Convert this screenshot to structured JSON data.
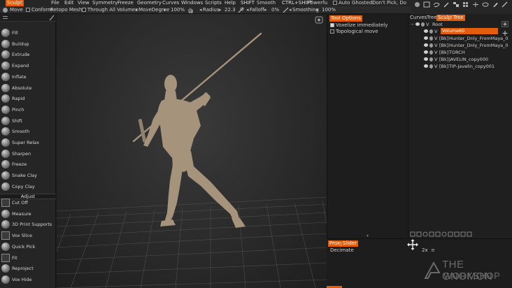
{
  "menubar": {
    "room": "Sculpt",
    "items": [
      "File",
      "Edit",
      "View",
      "Symmetry",
      "Freeze",
      "Geometry",
      "Curves",
      "Windows",
      "Scripts",
      "Help"
    ],
    "shift_label": "SHIFT",
    "shift_value": "Smooth",
    "ctrl_shift_label": "CTRL+SHIFT",
    "ctrl_shift_value": "Powerfu",
    "auto_label": "Auto",
    "ghosted_label": "Ghosted:",
    "ghosted_value": "Don't Pick, Do"
  },
  "options_bar": {
    "move": "Move",
    "conform": "Conform",
    "retopo_mesh": "Retopo  Mesh",
    "through_all_volumes": "Through  All  Volumes",
    "move_degree": "MoveDegree",
    "move_degree_value": "100%",
    "radius_label": "Radius",
    "radius_value": "22.3",
    "falloff_label": "Falloff",
    "falloff_value": "0%",
    "smoothing_label": "Smoothing",
    "smoothing_value": "100%"
  },
  "tools": [
    {
      "label": "Fill",
      "kind": "ball"
    },
    {
      "label": "Buildup",
      "kind": "ball"
    },
    {
      "label": "Extrude",
      "kind": "ball"
    },
    {
      "label": "Expand",
      "kind": "ball"
    },
    {
      "label": "Inflate",
      "kind": "ball"
    },
    {
      "label": "Absolute",
      "kind": "ball"
    },
    {
      "label": "Rapid",
      "kind": "ball"
    },
    {
      "label": "Pinch",
      "kind": "ball"
    },
    {
      "label": "Shift",
      "kind": "ball"
    },
    {
      "label": "Smooth",
      "kind": "ball"
    },
    {
      "label": "Super  Relax",
      "kind": "ball"
    },
    {
      "label": "Sharpen",
      "kind": "ball"
    },
    {
      "label": "Freeze",
      "kind": "ball"
    },
    {
      "label": "Snake  Clay",
      "kind": "ball"
    },
    {
      "label": "Copy  Clay",
      "kind": "ball"
    }
  ],
  "adjust_label": "Adjust",
  "adjust_tools": [
    {
      "label": "Cut  Off",
      "kind": "square"
    },
    {
      "label": "Measure",
      "kind": "ball"
    },
    {
      "label": "3D  Print  Supports",
      "kind": "ball"
    },
    {
      "label": "Vox  Slice",
      "kind": "square"
    },
    {
      "label": "Quick  Pick",
      "kind": "ball"
    },
    {
      "label": "Fit",
      "kind": "square"
    },
    {
      "label": "Reproject",
      "kind": "ball"
    },
    {
      "label": "Vox  Hide",
      "kind": "ball"
    }
  ],
  "tool_options": {
    "tab1": "Tool",
    "tab2": "Options",
    "voxelize": "Voxelize  immediately",
    "topological": "Topological  move"
  },
  "proxy": {
    "tab1": "Proxy",
    "tab2": "Slider",
    "decimate": "Decimate",
    "value": "2x"
  },
  "tree": {
    "tab_curves": "Curves",
    "tab_tree": "Tree",
    "tab_sculpt": "Sculpt",
    "tab_sculpt_tree": "Tree",
    "root": "Root",
    "items": [
      {
        "type": "",
        "name": "Volume60",
        "selected": true
      },
      {
        "type": "[Bk]",
        "name": "Hunter_Dnly_FromMaya_0",
        "selected": false
      },
      {
        "type": "[Bk]",
        "name": "Hunter_Dnly_FromMaya_0",
        "selected": false
      },
      {
        "type": "[Bk]",
        "name": "TORCH",
        "selected": false
      },
      {
        "type": "[Bk]",
        "name": "JAVELIN_copy000",
        "selected": false
      },
      {
        "type": "[Bk]",
        "name": "TIP-Javelin_copy001",
        "selected": false
      }
    ]
  },
  "watermark": {
    "line1": "THE GNOMON",
    "line2": "WORKSHOP"
  },
  "colors": {
    "accent": "#e35d0e",
    "background": "#1a1a1a",
    "figure": "#a5937c"
  },
  "icons": [
    "sculpt-room-icon",
    "move-icon",
    "radius-icon",
    "falloff-icon",
    "smoothing-icon",
    "eye-icon",
    "lock-icon",
    "add-icon",
    "move-cursor-icon",
    "gnomon-logo-icon"
  ]
}
